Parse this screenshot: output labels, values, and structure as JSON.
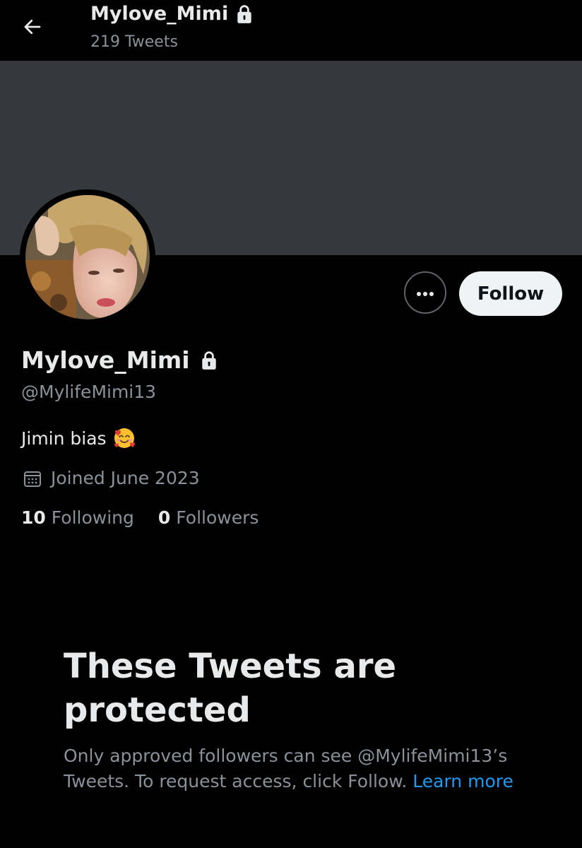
{
  "header": {
    "title": "Mylove_Mimi",
    "subtitle": "219 Tweets",
    "back_icon": "arrow-left-icon",
    "lock_icon": "lock-icon"
  },
  "profile": {
    "display_name": "Mylove_Mimi",
    "handle": "@MylifeMimi13",
    "bio": "Jimin bias",
    "bio_emoji": "smiling-face-with-hearts",
    "joined": "Joined June 2023",
    "following_count": "10",
    "following_label": "Following",
    "followers_count": "0",
    "followers_label": "Followers"
  },
  "actions": {
    "follow_label": "Follow",
    "more_icon": "more-horizontal-icon"
  },
  "protected": {
    "title": "These Tweets are protected",
    "body": "Only approved followers can see @MylifeMimi13’s Tweets. To request access, click Follow.",
    "link": "Learn more"
  },
  "colors": {
    "background": "#000000",
    "banner": "#35383c",
    "primary_text": "#e7e9ea",
    "secondary_text": "#8b9198",
    "link": "#1d9bf0",
    "follow_button_bg": "#eff3f4"
  }
}
